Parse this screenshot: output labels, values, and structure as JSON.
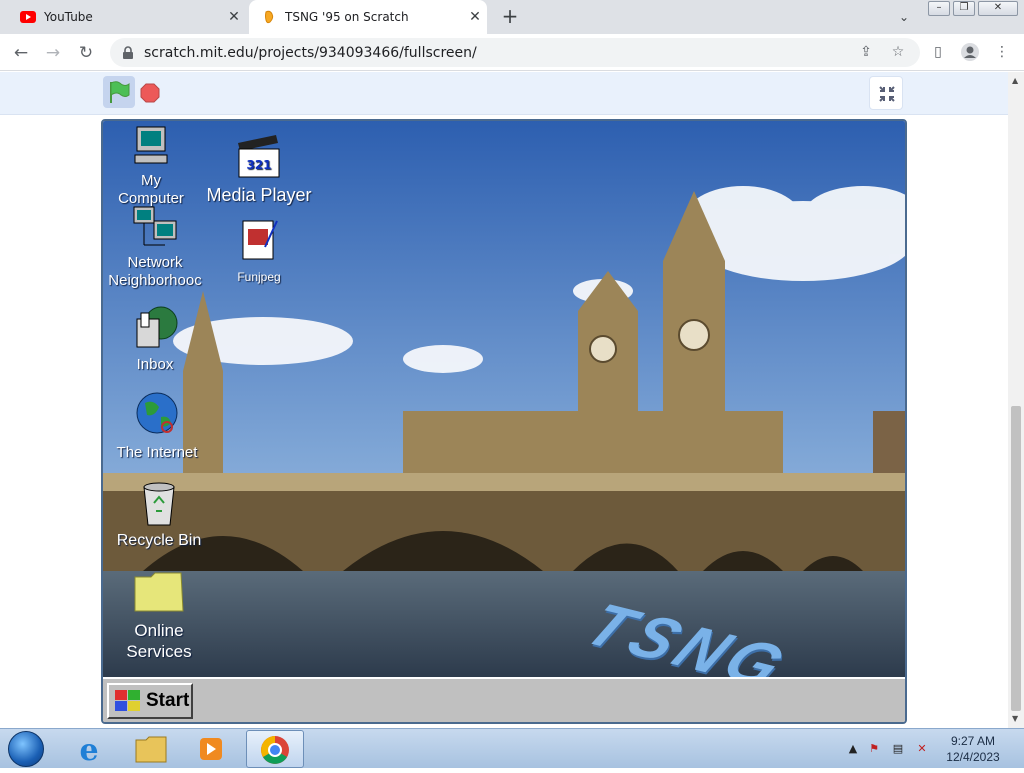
{
  "browser": {
    "tabs": [
      {
        "title": "YouTube",
        "active": false
      },
      {
        "title": "TSNG '95 on Scratch",
        "active": true
      }
    ],
    "url": "scratch.mit.edu/projects/934093466/fullscreen/"
  },
  "desktop": {
    "icons": [
      {
        "label": "My Computer",
        "icon": "computer-icon"
      },
      {
        "label": "Media Player",
        "icon": "clapperboard-icon",
        "clapper_text": "321"
      },
      {
        "label": "Network\nNeighborhooc",
        "icon": "network-icon"
      },
      {
        "label": "Funjpeg",
        "icon": "image-file-icon"
      },
      {
        "label": "Inbox",
        "icon": "inbox-icon"
      },
      {
        "label": "The Internet",
        "icon": "globe-icon"
      },
      {
        "label": "Recycle Bin",
        "icon": "recycle-bin-icon"
      },
      {
        "label": "Online\nServices",
        "icon": "folder-icon"
      }
    ],
    "logo_text": "TSNG",
    "start_label": "Start"
  },
  "os": {
    "clock_time": "9:27 AM",
    "clock_date": "12/4/2023"
  },
  "colors": {
    "chrome_tabbar": "#dee1e6",
    "stage_header": "#e9f1fc",
    "win95_gray": "#c0c0c0",
    "logo_blue": "#7ab2e8"
  }
}
